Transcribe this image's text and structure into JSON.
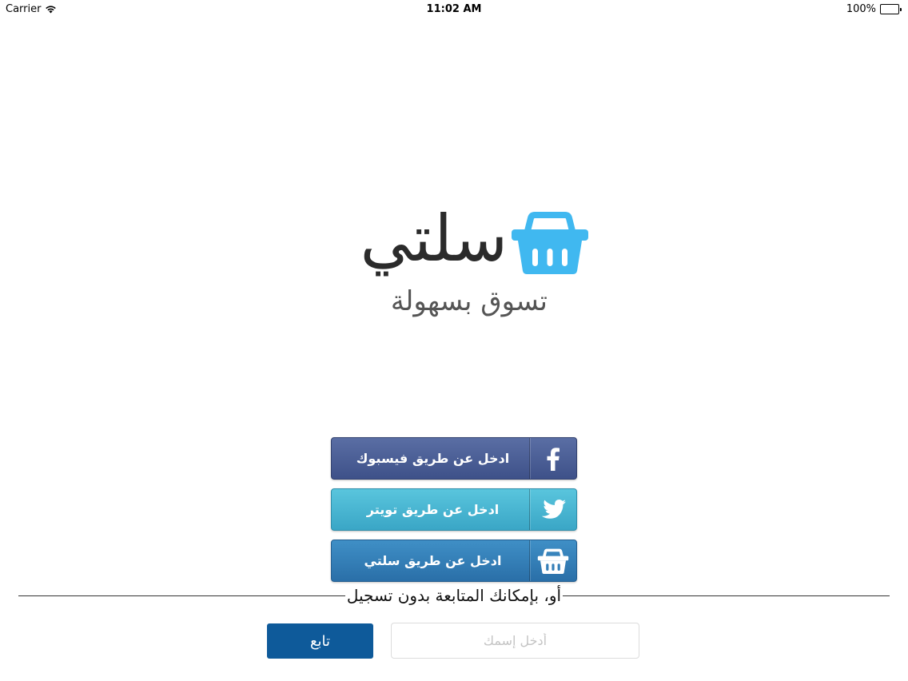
{
  "status_bar": {
    "carrier": "Carrier",
    "time": "11:02 AM",
    "battery": "100%",
    "icons": [
      "wifi-icon",
      "battery-icon"
    ]
  },
  "logo": {
    "wordmark": "سلتي",
    "tagline": "تسوق بسهولة",
    "icon": "basket-icon",
    "accent_color": "#40b8f0"
  },
  "login": {
    "facebook": {
      "label": "ادخل عن طريق فيسبوك",
      "icon": "facebook-icon",
      "color": "#4a5d96"
    },
    "twitter": {
      "label": "ادخل عن طريق تويتر",
      "icon": "twitter-bird-icon",
      "color": "#48b6d2"
    },
    "salati": {
      "label": "ادخل عن طريق سلتي",
      "icon": "basket-icon",
      "color": "#347fb8"
    }
  },
  "divider_text": "أو، بإمكانك المتابعة بدون تسجيل",
  "guest": {
    "continue_label": "تابع",
    "name_placeholder": "أدخل إسمك",
    "name_value": ""
  }
}
